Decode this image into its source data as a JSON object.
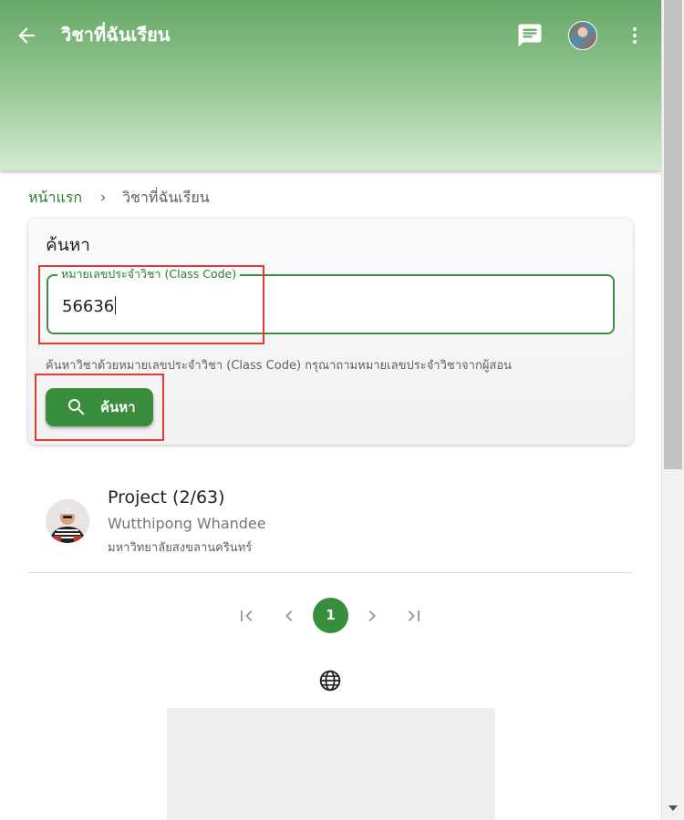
{
  "appbar": {
    "title": "วิชาที่ฉันเรียน",
    "icons": [
      "arrow-back-icon",
      "chat-icon",
      "avatar",
      "more-vert-icon"
    ]
  },
  "breadcrumb": {
    "home": "หน้าแรก",
    "current": "วิชาที่ฉันเรียน"
  },
  "search": {
    "title": "ค้นหา",
    "field_label": "หมายเลขประจำวิชา (Class Code)",
    "field_value": "56636",
    "hint": "ค้นหาวิชาด้วยหมายเลขประจำวิชา (Class Code) กรุณาถามหมายเลขประจำวิชาจากผู้สอน",
    "button_label": "ค้นหา"
  },
  "courses": [
    {
      "name": "Project (2/63)",
      "teacher": "Wutthipong Whandee",
      "organization": "มหาวิทยาลัยสงขลานครินทร์"
    }
  ],
  "pagination": {
    "current_page": "1"
  },
  "colors": {
    "primary": "#388e3c",
    "appbar_top": "#66a867",
    "highlight": "#e53935"
  }
}
